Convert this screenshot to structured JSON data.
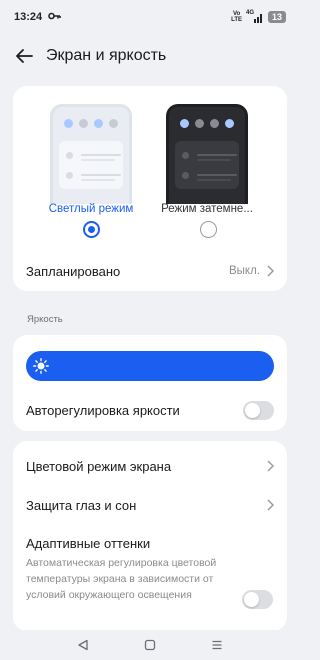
{
  "status_bar": {
    "time": "13:24",
    "volte": "Vo\nLTE",
    "network": "4G",
    "battery": "13"
  },
  "header": {
    "title": "Экран и яркость",
    "back_icon": "arrow-left-icon"
  },
  "theme": {
    "light_label": "Светлый режим",
    "dark_label": "Режим затемне...",
    "selected": "light",
    "scheduled_label": "Запланировано",
    "scheduled_value": "Выкл.",
    "accent_color": "#1a5ff0"
  },
  "brightness": {
    "section_label": "Яркость",
    "level": 1.0,
    "auto_label": "Авторегулировка яркости",
    "auto_enabled": false
  },
  "options": {
    "color_mode_label": "Цветовой режим экрана",
    "eye_protection_label": "Защита глаз и сон",
    "adaptive_title": "Адаптивные оттенки",
    "adaptive_desc": "Автоматическая регулировка цветовой температуры экрана в зависимости от условий окружающего освещения",
    "adaptive_enabled": false
  },
  "nav_bar": {
    "back_icon": "triangle-back-icon",
    "home_icon": "square-home-icon",
    "menu_icon": "menu-lines-icon"
  }
}
